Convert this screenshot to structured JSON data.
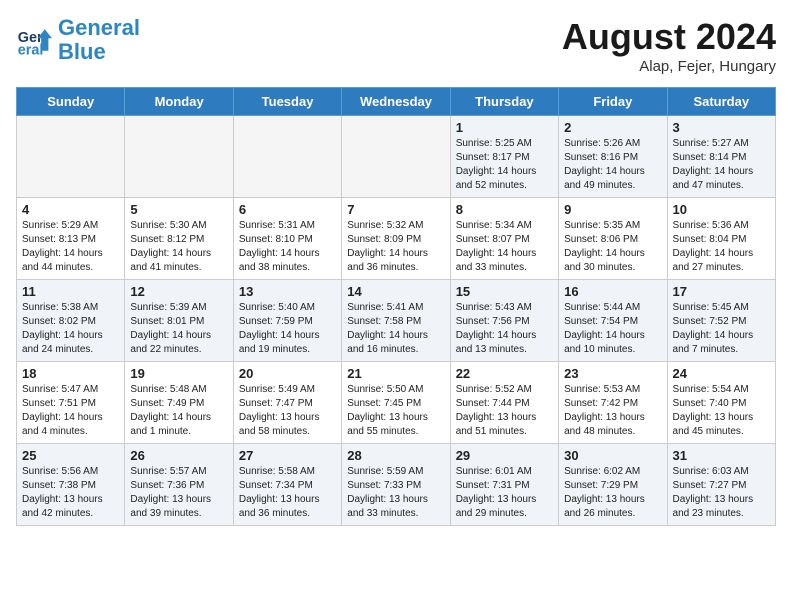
{
  "header": {
    "logo_line1": "General",
    "logo_line2": "Blue",
    "month": "August 2024",
    "location": "Alap, Fejer, Hungary"
  },
  "weekdays": [
    "Sunday",
    "Monday",
    "Tuesday",
    "Wednesday",
    "Thursday",
    "Friday",
    "Saturday"
  ],
  "weeks": [
    [
      {
        "day": "",
        "info": ""
      },
      {
        "day": "",
        "info": ""
      },
      {
        "day": "",
        "info": ""
      },
      {
        "day": "",
        "info": ""
      },
      {
        "day": "1",
        "info": "Sunrise: 5:25 AM\nSunset: 8:17 PM\nDaylight: 14 hours\nand 52 minutes."
      },
      {
        "day": "2",
        "info": "Sunrise: 5:26 AM\nSunset: 8:16 PM\nDaylight: 14 hours\nand 49 minutes."
      },
      {
        "day": "3",
        "info": "Sunrise: 5:27 AM\nSunset: 8:14 PM\nDaylight: 14 hours\nand 47 minutes."
      }
    ],
    [
      {
        "day": "4",
        "info": "Sunrise: 5:29 AM\nSunset: 8:13 PM\nDaylight: 14 hours\nand 44 minutes."
      },
      {
        "day": "5",
        "info": "Sunrise: 5:30 AM\nSunset: 8:12 PM\nDaylight: 14 hours\nand 41 minutes."
      },
      {
        "day": "6",
        "info": "Sunrise: 5:31 AM\nSunset: 8:10 PM\nDaylight: 14 hours\nand 38 minutes."
      },
      {
        "day": "7",
        "info": "Sunrise: 5:32 AM\nSunset: 8:09 PM\nDaylight: 14 hours\nand 36 minutes."
      },
      {
        "day": "8",
        "info": "Sunrise: 5:34 AM\nSunset: 8:07 PM\nDaylight: 14 hours\nand 33 minutes."
      },
      {
        "day": "9",
        "info": "Sunrise: 5:35 AM\nSunset: 8:06 PM\nDaylight: 14 hours\nand 30 minutes."
      },
      {
        "day": "10",
        "info": "Sunrise: 5:36 AM\nSunset: 8:04 PM\nDaylight: 14 hours\nand 27 minutes."
      }
    ],
    [
      {
        "day": "11",
        "info": "Sunrise: 5:38 AM\nSunset: 8:02 PM\nDaylight: 14 hours\nand 24 minutes."
      },
      {
        "day": "12",
        "info": "Sunrise: 5:39 AM\nSunset: 8:01 PM\nDaylight: 14 hours\nand 22 minutes."
      },
      {
        "day": "13",
        "info": "Sunrise: 5:40 AM\nSunset: 7:59 PM\nDaylight: 14 hours\nand 19 minutes."
      },
      {
        "day": "14",
        "info": "Sunrise: 5:41 AM\nSunset: 7:58 PM\nDaylight: 14 hours\nand 16 minutes."
      },
      {
        "day": "15",
        "info": "Sunrise: 5:43 AM\nSunset: 7:56 PM\nDaylight: 14 hours\nand 13 minutes."
      },
      {
        "day": "16",
        "info": "Sunrise: 5:44 AM\nSunset: 7:54 PM\nDaylight: 14 hours\nand 10 minutes."
      },
      {
        "day": "17",
        "info": "Sunrise: 5:45 AM\nSunset: 7:52 PM\nDaylight: 14 hours\nand 7 minutes."
      }
    ],
    [
      {
        "day": "18",
        "info": "Sunrise: 5:47 AM\nSunset: 7:51 PM\nDaylight: 14 hours\nand 4 minutes."
      },
      {
        "day": "19",
        "info": "Sunrise: 5:48 AM\nSunset: 7:49 PM\nDaylight: 14 hours\nand 1 minute."
      },
      {
        "day": "20",
        "info": "Sunrise: 5:49 AM\nSunset: 7:47 PM\nDaylight: 13 hours\nand 58 minutes."
      },
      {
        "day": "21",
        "info": "Sunrise: 5:50 AM\nSunset: 7:45 PM\nDaylight: 13 hours\nand 55 minutes."
      },
      {
        "day": "22",
        "info": "Sunrise: 5:52 AM\nSunset: 7:44 PM\nDaylight: 13 hours\nand 51 minutes."
      },
      {
        "day": "23",
        "info": "Sunrise: 5:53 AM\nSunset: 7:42 PM\nDaylight: 13 hours\nand 48 minutes."
      },
      {
        "day": "24",
        "info": "Sunrise: 5:54 AM\nSunset: 7:40 PM\nDaylight: 13 hours\nand 45 minutes."
      }
    ],
    [
      {
        "day": "25",
        "info": "Sunrise: 5:56 AM\nSunset: 7:38 PM\nDaylight: 13 hours\nand 42 minutes."
      },
      {
        "day": "26",
        "info": "Sunrise: 5:57 AM\nSunset: 7:36 PM\nDaylight: 13 hours\nand 39 minutes."
      },
      {
        "day": "27",
        "info": "Sunrise: 5:58 AM\nSunset: 7:34 PM\nDaylight: 13 hours\nand 36 minutes."
      },
      {
        "day": "28",
        "info": "Sunrise: 5:59 AM\nSunset: 7:33 PM\nDaylight: 13 hours\nand 33 minutes."
      },
      {
        "day": "29",
        "info": "Sunrise: 6:01 AM\nSunset: 7:31 PM\nDaylight: 13 hours\nand 29 minutes."
      },
      {
        "day": "30",
        "info": "Sunrise: 6:02 AM\nSunset: 7:29 PM\nDaylight: 13 hours\nand 26 minutes."
      },
      {
        "day": "31",
        "info": "Sunrise: 6:03 AM\nSunset: 7:27 PM\nDaylight: 13 hours\nand 23 minutes."
      }
    ]
  ]
}
